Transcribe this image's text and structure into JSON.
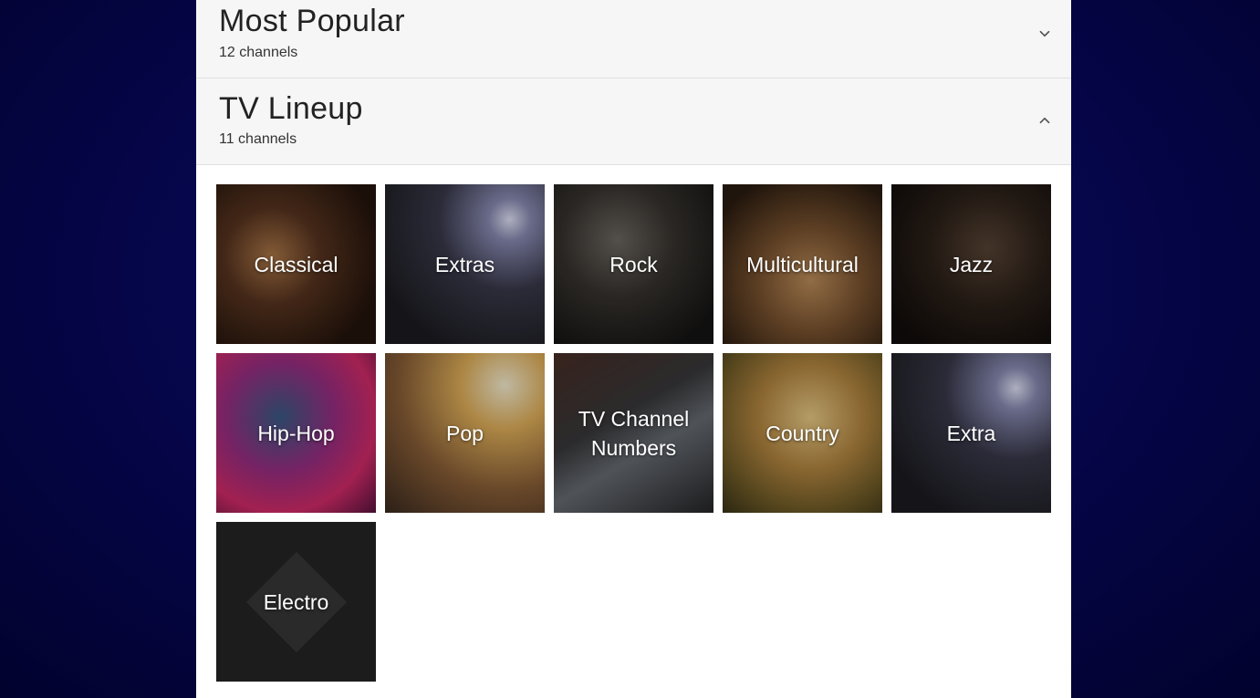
{
  "sections": [
    {
      "title": "Most Popular",
      "count": "12 channels",
      "expanded": false,
      "chevron_icon": "chevron-down-icon"
    },
    {
      "title": "TV Lineup",
      "count": "11 channels",
      "expanded": true,
      "chevron_icon": "chevron-up-icon"
    }
  ],
  "lineup": {
    "tiles": [
      {
        "label": "Classical"
      },
      {
        "label": "Extras"
      },
      {
        "label": "Rock"
      },
      {
        "label": "Multicultural"
      },
      {
        "label": "Jazz"
      },
      {
        "label": "Hip-Hop"
      },
      {
        "label": "Pop"
      },
      {
        "label": "TV Channel Numbers"
      },
      {
        "label": "Country"
      },
      {
        "label": "Extra"
      },
      {
        "label": "Electro"
      }
    ]
  },
  "colors": {
    "background": "#060650",
    "panel": "#ffffff",
    "header": "#f6f6f6"
  }
}
